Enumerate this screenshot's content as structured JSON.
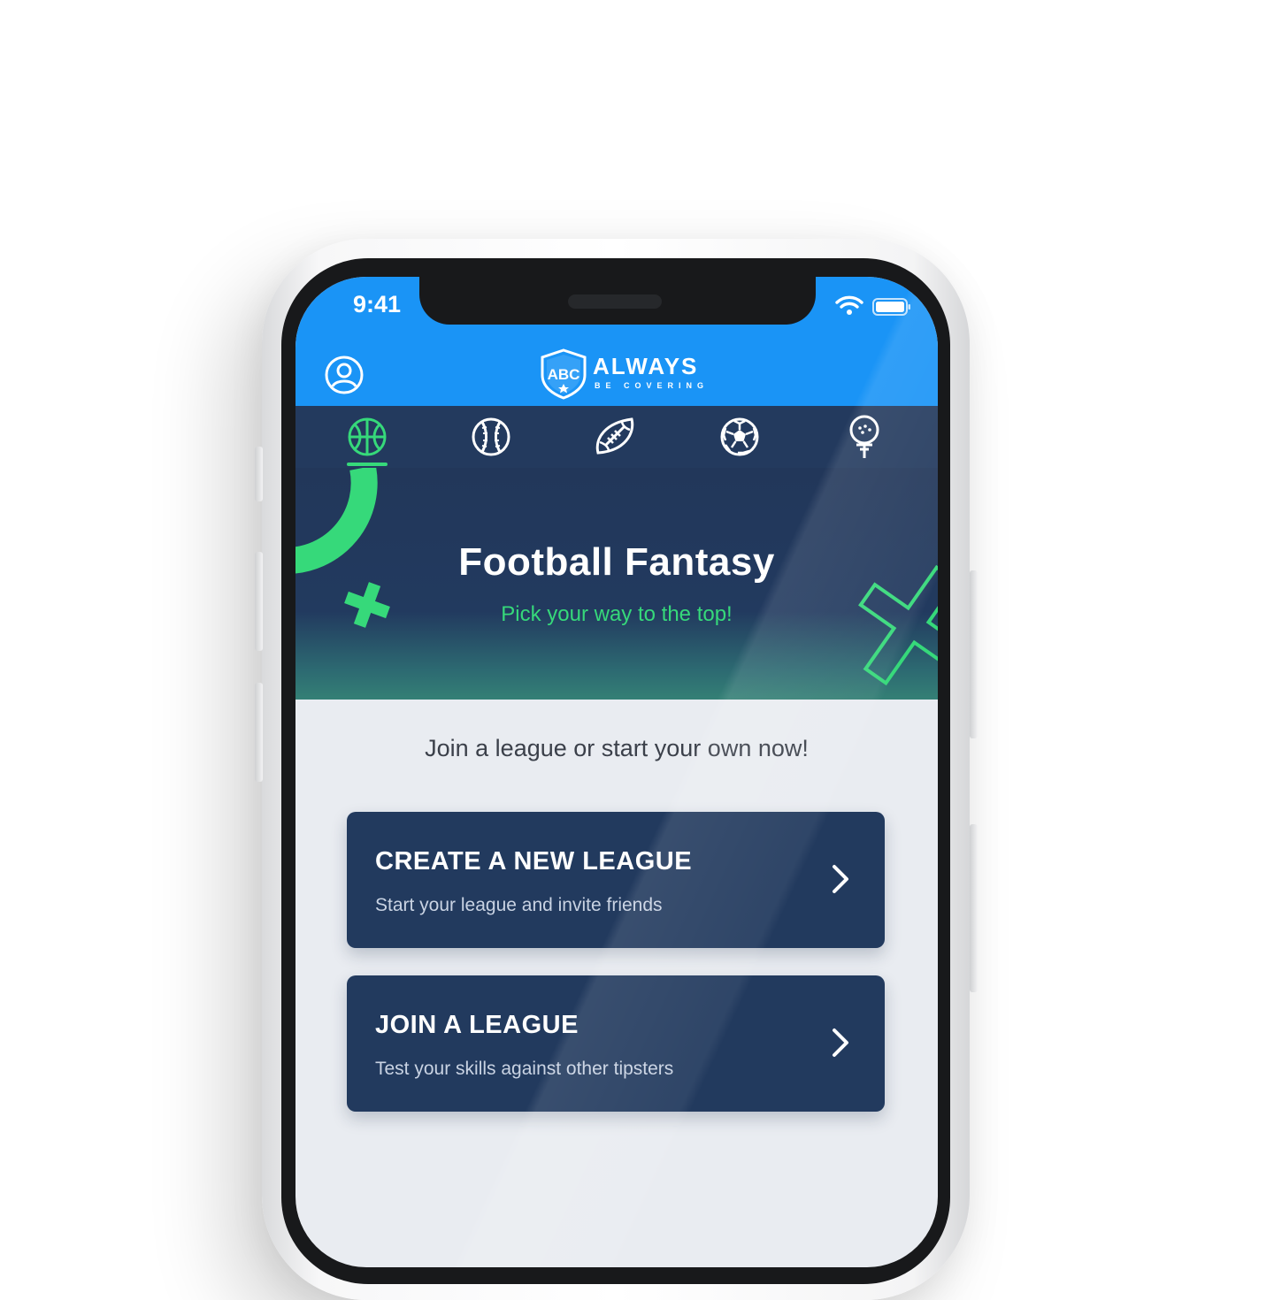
{
  "status_bar": {
    "time": "9:41",
    "icons": [
      "wifi-icon",
      "battery-icon"
    ]
  },
  "app_bar": {
    "profile_icon": "user-circle-icon",
    "logo": {
      "badge": "ABC",
      "name": "ALWAYS",
      "tagline": "BE COVERING"
    }
  },
  "sport_tabs": [
    {
      "icon": "basketball-icon",
      "active": true
    },
    {
      "icon": "baseball-icon",
      "active": false
    },
    {
      "icon": "american-football-icon",
      "active": false
    },
    {
      "icon": "soccer-ball-icon",
      "active": false
    },
    {
      "icon": "golf-ball-icon",
      "active": false
    }
  ],
  "hero": {
    "title": "Football Fantasy",
    "subtitle": "Pick your way to the top!"
  },
  "main": {
    "tagline": "Join a league or start your own now!",
    "cards": [
      {
        "title": "CREATE A NEW LEAGUE",
        "subtitle": "Start your league and invite friends"
      },
      {
        "title": "JOIN A LEAGUE",
        "subtitle": "Test your skills against other tipsters"
      }
    ]
  },
  "colors": {
    "app_bar": "#1a94f6",
    "navy": "#223a5e",
    "accent_green": "#36d97a",
    "background": "#e9ecf1"
  }
}
